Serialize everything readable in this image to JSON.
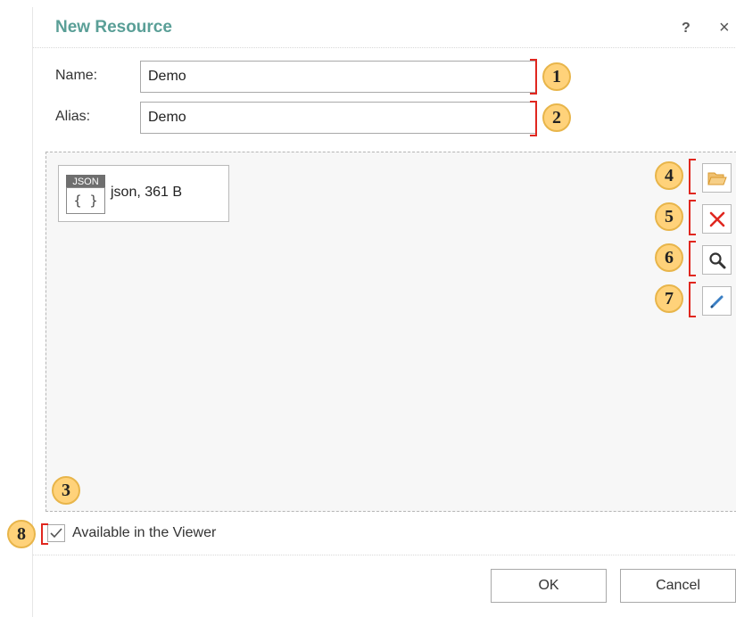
{
  "dialog": {
    "title": "New Resource",
    "help_label": "?",
    "close_label": "×"
  },
  "form": {
    "name_label": "Name:",
    "name_value": "Demo",
    "alias_label": "Alias:",
    "alias_value": "Demo"
  },
  "resource": {
    "icon_badge": "JSON",
    "icon_glyph": "{ }",
    "label": "json, 361 B"
  },
  "side_buttons": [
    {
      "icon": "folder-open-icon",
      "color": "#f0b44c"
    },
    {
      "icon": "delete-icon",
      "color": "#e0271f"
    },
    {
      "icon": "search-icon",
      "color": "#333333"
    },
    {
      "icon": "edit-icon",
      "color": "#3b7fc4"
    }
  ],
  "checkbox": {
    "label": "Available in the Viewer",
    "checked": true
  },
  "footer": {
    "ok_label": "OK",
    "cancel_label": "Cancel"
  },
  "callouts": {
    "c1": "1",
    "c2": "2",
    "c3": "3",
    "c4": "4",
    "c5": "5",
    "c6": "6",
    "c7": "7",
    "c8": "8"
  },
  "colors": {
    "title": "#5a9f97",
    "callout_fill": "#ffd27a",
    "bracket": "#e0271f"
  }
}
